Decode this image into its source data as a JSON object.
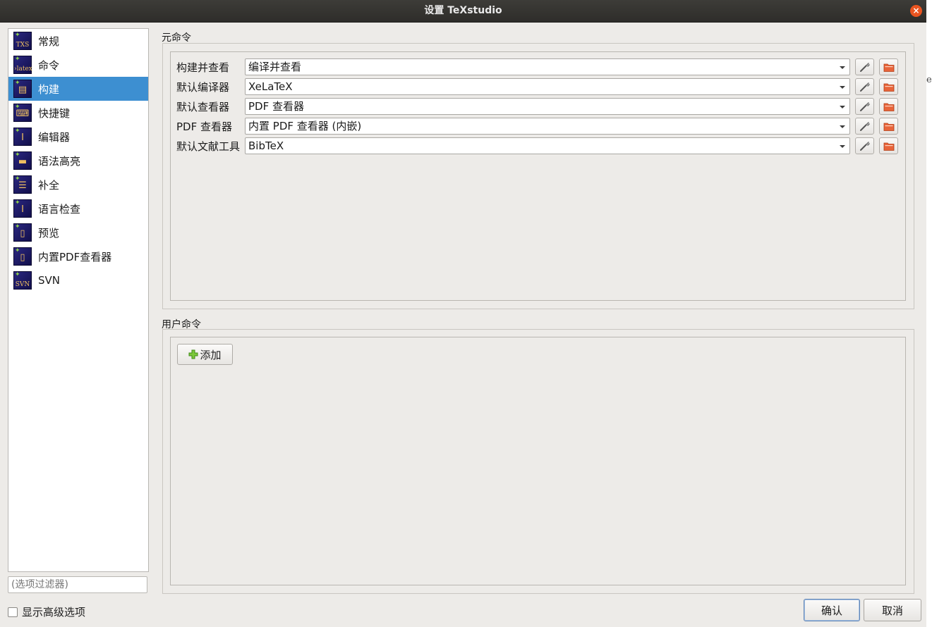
{
  "window": {
    "title": "设置 TeXstudio",
    "close_glyph": "×"
  },
  "background_letter": "e",
  "sidebar": {
    "items": [
      {
        "label": "常规",
        "icon": "txs-icon",
        "icon_caption": "TXS",
        "icon_glyph": ""
      },
      {
        "label": "命令",
        "icon": "latex-icon",
        "icon_caption": "›latex",
        "icon_glyph": ""
      },
      {
        "label": "构建",
        "icon": "build-icon",
        "icon_caption": "",
        "icon_glyph": "▤"
      },
      {
        "label": "快捷键",
        "icon": "keyboard-icon",
        "icon_caption": "",
        "icon_glyph": "⌨"
      },
      {
        "label": "编辑器",
        "icon": "text-cursor-icon",
        "icon_caption": "",
        "icon_glyph": "I"
      },
      {
        "label": "语法高亮",
        "icon": "highlight-icon",
        "icon_caption": "",
        "icon_glyph": "▬"
      },
      {
        "label": "补全",
        "icon": "completion-icon",
        "icon_caption": "",
        "icon_glyph": "☰"
      },
      {
        "label": "语言检查",
        "icon": "spellcheck-icon",
        "icon_caption": "",
        "icon_glyph": "I"
      },
      {
        "label": "预览",
        "icon": "preview-icon",
        "icon_caption": "",
        "icon_glyph": "▯"
      },
      {
        "label": "内置PDF查看器",
        "icon": "pdf-viewer-icon",
        "icon_caption": "",
        "icon_glyph": "▯"
      },
      {
        "label": "SVN",
        "icon": "svn-icon",
        "icon_caption": "SVN",
        "icon_glyph": ""
      }
    ],
    "selected": "构建",
    "filter_placeholder": "(选项过滤器)",
    "advanced_label": "显示高级选项",
    "advanced_checked": false
  },
  "meta_commands": {
    "title": "元命令",
    "rows": [
      {
        "label": "构建并查看",
        "value": "编译并查看"
      },
      {
        "label": "默认编译器",
        "value": "XeLaTeX"
      },
      {
        "label": "默认查看器",
        "value": "PDF 查看器"
      },
      {
        "label": "PDF 查看器",
        "value": "内置 PDF 查看器 (内嵌)"
      },
      {
        "label": "默认文献工具",
        "value": "BibTeX"
      }
    ]
  },
  "user_commands": {
    "title": "用户命令",
    "add_label": "添加"
  },
  "buttons": {
    "ok": "确认",
    "cancel": "取消"
  },
  "colors": {
    "selection": "#3d8fd1",
    "close_button": "#e95420",
    "titlebar": "#2e2d2a"
  }
}
